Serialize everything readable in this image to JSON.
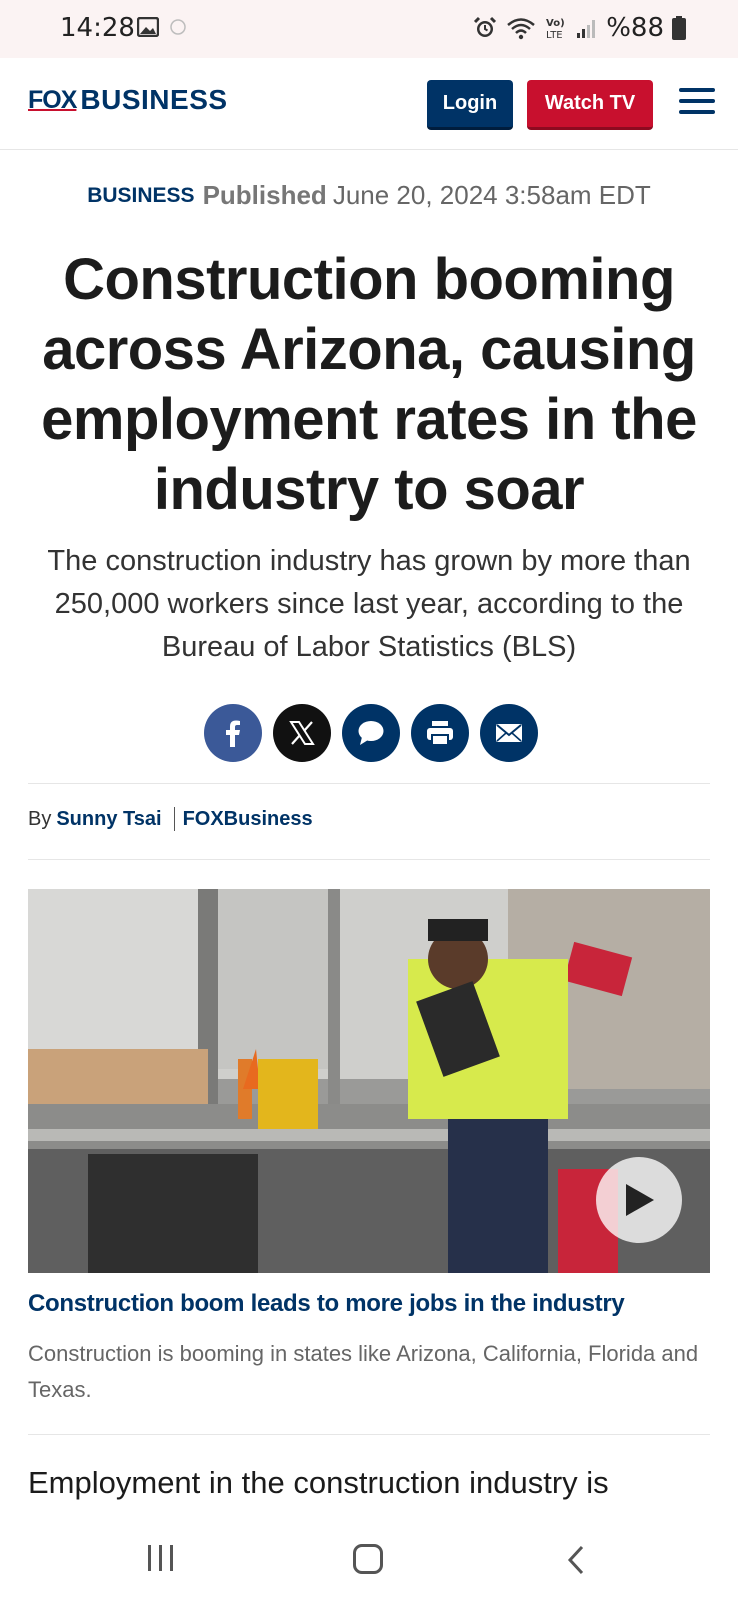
{
  "status_bar": {
    "time": "14:28",
    "battery": "%88",
    "icons": [
      "image-icon",
      "loading-circle-icon",
      "alarm-icon",
      "wifi-icon",
      "volte-icon",
      "signal-icon",
      "battery-icon"
    ]
  },
  "header": {
    "logo_fox": "FOX",
    "logo_business": "BUSINESS",
    "login_label": "Login",
    "watch_tv_label": "Watch TV",
    "colors": {
      "brand_blue": "#003366",
      "brand_red": "#c8102e"
    }
  },
  "article": {
    "eyebrow": "BUSINESS",
    "published_label": "Published",
    "published_date": "June 20, 2024 3:58am EDT",
    "headline": "Construction booming across Arizona, causing employment rates in the industry to soar",
    "dek": "The construction industry has grown by more than 250,000 workers since last year, according to the Bureau of Labor Statistics (BLS)",
    "share_buttons": [
      "facebook-icon",
      "x-icon",
      "comment-icon",
      "print-icon",
      "email-icon"
    ],
    "byline_prefix": "By",
    "author": "Sunny Tsai",
    "outlet": "FOXBusiness",
    "body_start": "Employment in the construction industry is"
  },
  "video": {
    "title": "Construction boom leads to more jobs in the industry",
    "caption": "Construction is booming in states like Arizona, California, Florida and Texas."
  },
  "nav_bar": {
    "buttons": [
      "recent-apps-icon",
      "home-icon",
      "back-icon"
    ]
  }
}
